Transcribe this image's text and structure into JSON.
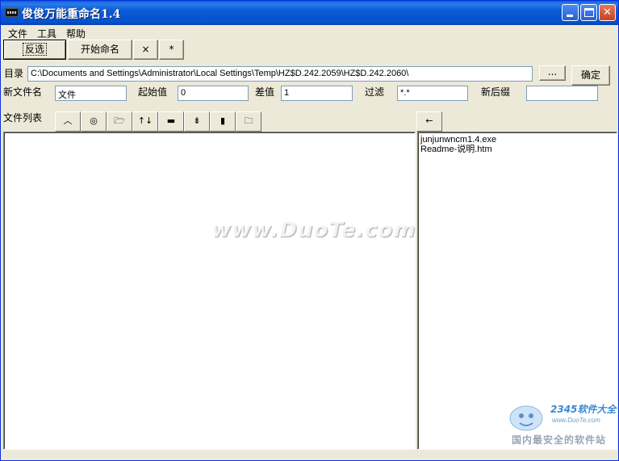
{
  "window": {
    "title": "俊俊万能重命名1.4"
  },
  "menu": [
    "文件",
    "工具",
    "帮助"
  ],
  "toolbar": {
    "invert_label": "反选",
    "start_label": "开始命名",
    "x_label": "×",
    "star_label": "*"
  },
  "directory": {
    "label": "目录",
    "value": "C:\\Documents and Settings\\Administrator\\Local Settings\\Temp\\HZ$D.242.2059\\HZ$D.242.2060\\",
    "browse_label": "...",
    "ok_label": "确定"
  },
  "fields": {
    "new_name": {
      "label": "新文件名",
      "value": "文件"
    },
    "start_value": {
      "label": "起始值",
      "value": "0"
    },
    "step": {
      "label": "差值",
      "value": "1"
    },
    "filter": {
      "label": "过滤",
      "value": "*.*"
    },
    "new_ext": {
      "label": "新后缀",
      "value": ""
    }
  },
  "file_list": {
    "label": "文件列表",
    "back_label": "←"
  },
  "tools": [
    {
      "icon": "caret-up-icon",
      "glyph": "︿"
    },
    {
      "icon": "target-icon",
      "glyph": "◎"
    },
    {
      "icon": "open-folder-icon",
      "glyph": "🗁"
    },
    {
      "icon": "swap-updown-icon",
      "glyph": "↑↓"
    },
    {
      "icon": "bar-icon",
      "glyph": "▬"
    },
    {
      "icon": "double-arrow-icon",
      "glyph": "⇟"
    },
    {
      "icon": "device-icon",
      "glyph": "▮"
    },
    {
      "icon": "folder-icon",
      "glyph": "🗀"
    }
  ],
  "files": [
    "junjunwncm1.4.exe",
    "Readme-说明.htm"
  ],
  "watermarks": {
    "duote": "www.DuoTe.com",
    "logo": "2345软件大全",
    "logo_url": "www.DuoTe.com",
    "slogan": "国内最安全的软件站"
  },
  "colors": {
    "titlebar": "#0a5ad6",
    "face": "#ece9d8",
    "close": "#c8401e"
  }
}
